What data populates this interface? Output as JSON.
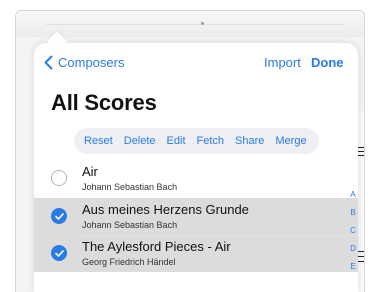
{
  "nav": {
    "back_label": "Composers",
    "import_label": "Import",
    "done_label": "Done"
  },
  "page_title": "All Scores",
  "actions": [
    "Reset",
    "Delete",
    "Edit",
    "Fetch",
    "Share",
    "Merge"
  ],
  "scores": [
    {
      "title": "Air",
      "composer": "Johann Sebastian Bach",
      "selected": false
    },
    {
      "title": "Aus meines Herzens Grunde",
      "composer": "Johann Sebastian Bach",
      "selected": true
    },
    {
      "title": "The Aylesford Pieces - Air",
      "composer": "Georg Friedrich Händel",
      "selected": true
    }
  ],
  "section_index": [
    "A",
    "B",
    "C",
    "D",
    "E"
  ],
  "colors": {
    "accent": "#2a7be4",
    "selected_row": "#dcdcdc",
    "action_bar": "#eef0f3"
  }
}
